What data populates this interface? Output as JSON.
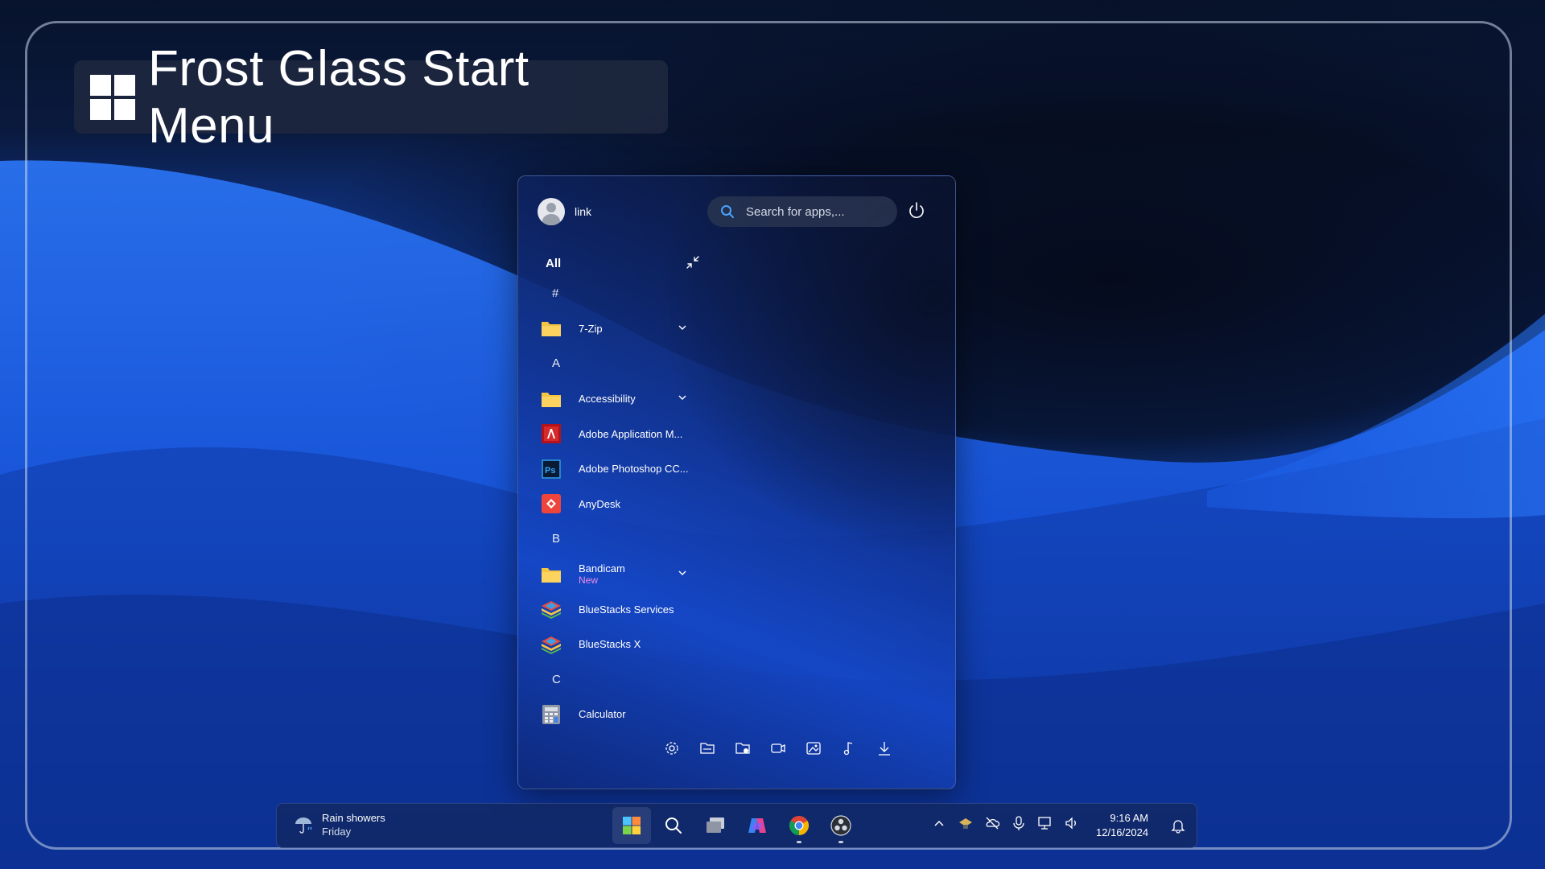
{
  "banner": {
    "title": "Frost Glass Start Menu"
  },
  "start_menu": {
    "user": {
      "name": "link"
    },
    "search": {
      "placeholder": "Search for apps,..."
    },
    "section_label": "All",
    "groups": [
      {
        "letter": "#",
        "apps": [
          {
            "name": "7-Zip",
            "icon": "folder-icon",
            "expandable": true
          }
        ]
      },
      {
        "letter": "A",
        "apps": [
          {
            "name": "Accessibility",
            "icon": "folder-icon",
            "expandable": true
          },
          {
            "name": "Adobe Application M...",
            "icon": "adobe-icon"
          },
          {
            "name": "Adobe Photoshop CC...",
            "icon": "photoshop-icon"
          },
          {
            "name": "AnyDesk",
            "icon": "anydesk-icon"
          }
        ]
      },
      {
        "letter": "B",
        "apps": [
          {
            "name": "Bandicam",
            "sub": "New",
            "icon": "folder-icon",
            "expandable": true
          },
          {
            "name": "BlueStacks Services",
            "icon": "bluestacks-icon"
          },
          {
            "name": "BlueStacks X",
            "icon": "bluestacks-icon"
          }
        ]
      },
      {
        "letter": "C",
        "apps": [
          {
            "name": "Calculator",
            "icon": "calculator-icon"
          }
        ]
      }
    ],
    "quick_links": [
      "settings-icon",
      "documents-icon",
      "file-explorer-icon",
      "videos-icon",
      "pictures-icon",
      "music-icon",
      "downloads-icon"
    ]
  },
  "taskbar": {
    "weather": {
      "condition": "Rain showers",
      "day": "Friday"
    },
    "clock": {
      "time": "9:16 AM",
      "date": "12/16/2024"
    }
  }
}
